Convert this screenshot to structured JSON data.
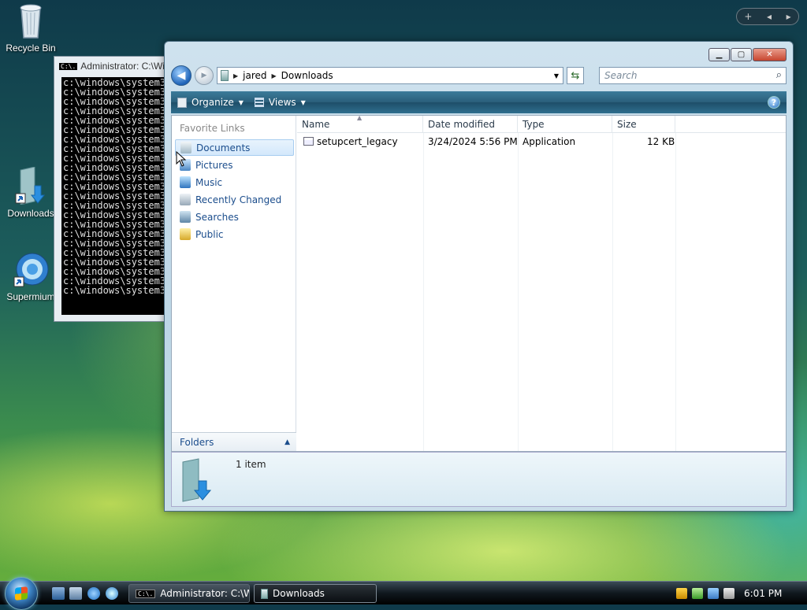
{
  "desktop": {
    "icons": [
      {
        "label": "Recycle Bin"
      },
      {
        "label": "Downloads"
      },
      {
        "label": "Supermium"
      }
    ]
  },
  "sidebar_gadget": {
    "add": "+",
    "prev": "◂",
    "next": "▸"
  },
  "console": {
    "title": "Administrator: C:\\Windows\\System32\\cmd.exe",
    "icon_text": "C:\\.",
    "line": "c:\\windows\\system32>",
    "line_count": 23
  },
  "explorer": {
    "nav": {
      "back": "◀",
      "forward": "▶"
    },
    "breadcrumb": [
      "jared",
      "Downloads"
    ],
    "search_placeholder": "Search",
    "toolbar": {
      "organize": "Organize",
      "views": "Views",
      "help": "?"
    },
    "favorite_links_title": "Favorite Links",
    "favorite_links": [
      {
        "label": "Documents",
        "icon": "documents-icon",
        "selected": true
      },
      {
        "label": "Pictures",
        "icon": "pictures-icon"
      },
      {
        "label": "Music",
        "icon": "music-icon"
      },
      {
        "label": "Recently Changed",
        "icon": "recently-changed-icon"
      },
      {
        "label": "Searches",
        "icon": "searches-icon"
      },
      {
        "label": "Public",
        "icon": "public-folder-icon"
      }
    ],
    "folders_label": "Folders",
    "columns": [
      "Name",
      "Date modified",
      "Type",
      "Size"
    ],
    "files": [
      {
        "name": "setupcert_legacy",
        "date": "3/24/2024 5:56 PM",
        "type": "Application",
        "size": "12 KB"
      }
    ],
    "details": {
      "item_count": "1 item"
    }
  },
  "taskbar": {
    "tasks": [
      {
        "label": "Administrator: C:\\W..."
      },
      {
        "label": "Downloads"
      }
    ],
    "clock": "6:01 PM"
  },
  "colors": {
    "link_blue": "#1b4d8c",
    "toolbar_teal": "#2a5e7a",
    "selection": "#d3e8fb"
  }
}
